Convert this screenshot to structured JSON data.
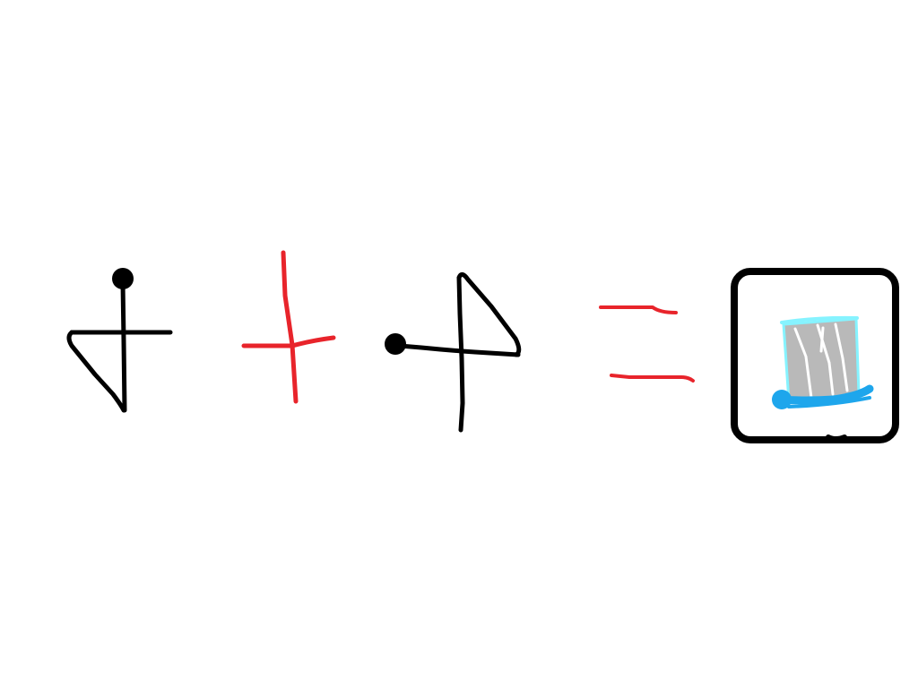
{
  "drawing": {
    "symbols": [
      {
        "name": "glyph-arrow-down-left",
        "color": "#000000"
      },
      {
        "name": "plus-operator",
        "color": "#e8242b"
      },
      {
        "name": "glyph-flag-right",
        "color": "#000000"
      },
      {
        "name": "equals-operator",
        "color": "#e8242b"
      },
      {
        "name": "result-boat-icon",
        "color": "#000000"
      }
    ],
    "colors": {
      "ink": "#000000",
      "operator": "#e8242b",
      "sail_fill": "#b9b9b9",
      "sail_outline": "#86f3ff",
      "water": "#1ea6ec",
      "background": "#ffffff"
    }
  }
}
